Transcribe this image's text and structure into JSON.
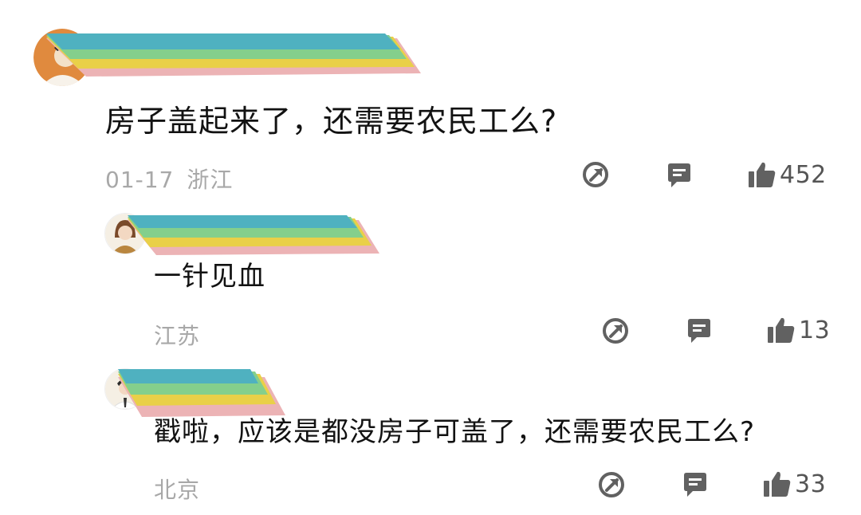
{
  "comments": [
    {
      "text": "房子盖起来了，还需要农民工么?",
      "date": "01-17",
      "location": "浙江",
      "likes": "452",
      "icons": {
        "share": "share-icon",
        "reply": "reply-icon",
        "like": "thumbs-up-icon"
      },
      "replies": [
        {
          "text": "一针见血",
          "location": "江苏",
          "likes": "13"
        },
        {
          "text": "戳啦，应该是都没房子可盖了，还需要农民工么?",
          "location": "北京",
          "likes": "33"
        }
      ]
    }
  ],
  "colors": {
    "redact_teal": "#4fb1c0",
    "redact_green": "#84cf8c",
    "redact_yellow": "#e9d048",
    "redact_pink": "#ecb3b5",
    "icon_gray": "#616161",
    "meta_gray": "#a8a8a8"
  }
}
